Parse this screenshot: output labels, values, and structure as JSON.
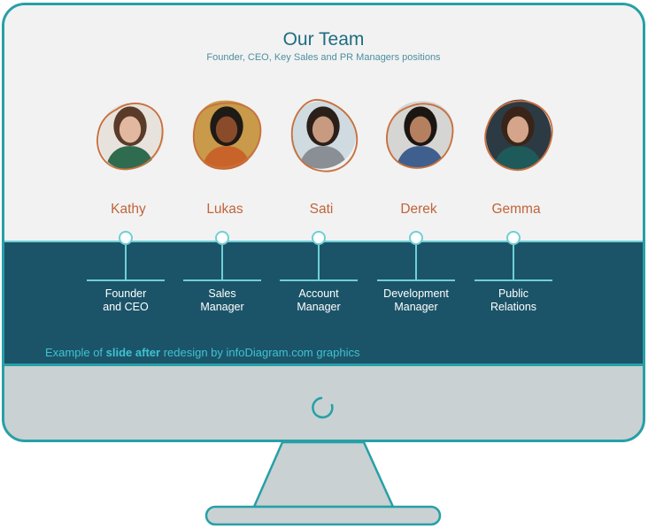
{
  "slide": {
    "title": "Our Team",
    "subtitle": "Founder, CEO, Key Sales and PR Managers positions"
  },
  "team": [
    {
      "name": "Kathy",
      "role_line1": "Founder",
      "role_line2": "and CEO",
      "photo": "portrait-woman-curly-hair"
    },
    {
      "name": "Lukas",
      "role_line1": "Sales",
      "role_line2": "Manager",
      "photo": "portrait-man-orange-jacket"
    },
    {
      "name": "Sati",
      "role_line1": "Account",
      "role_line2": "Manager",
      "photo": "portrait-woman-glasses"
    },
    {
      "name": "Derek",
      "role_line1": "Development",
      "role_line2": "Manager",
      "photo": "portrait-man-blue-tshirt"
    },
    {
      "name": "Gemma",
      "role_line1": "Public",
      "role_line2": "Relations",
      "photo": "portrait-woman-long-hair"
    }
  ],
  "footer": {
    "prefix": "Example of ",
    "bold": "slide after",
    "suffix": " redesign by infoDiagram.com graphics"
  },
  "colors": {
    "frame": "#26a0a6",
    "band": "#1b5468",
    "accent_orange": "#c0643a",
    "title_teal": "#1f6d80",
    "connector": "#6fcfd6"
  },
  "icons": {
    "camera": "power-ring-icon"
  }
}
